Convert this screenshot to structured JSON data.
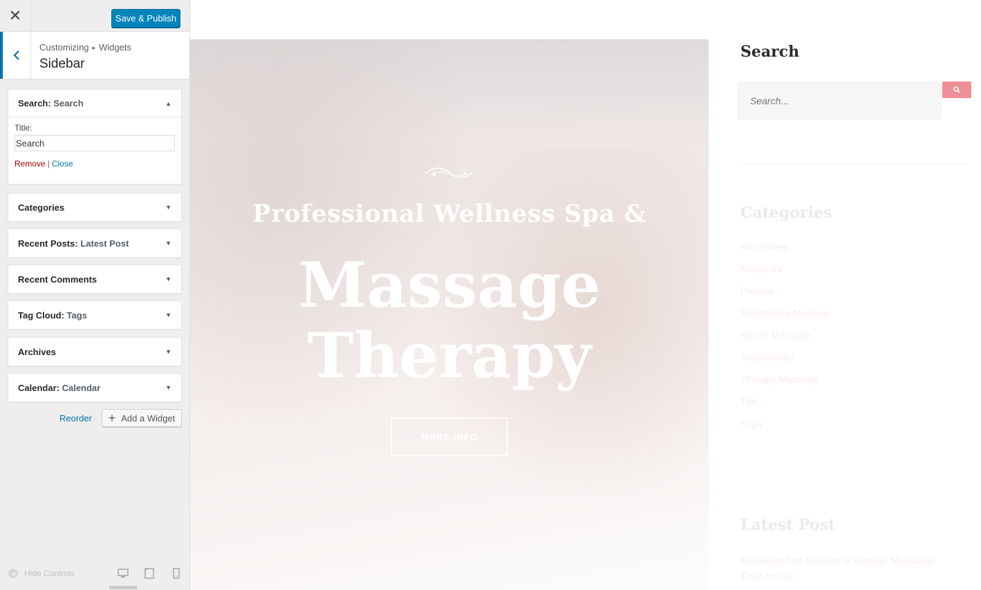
{
  "panel": {
    "close_icon": "close-icon",
    "publish_label": "Save & Publish",
    "breadcrumb_root": "Customizing",
    "breadcrumb_sep": "▸",
    "breadcrumb_current": "Widgets",
    "section_title": "Sidebar",
    "widgets": [
      {
        "type": "Search",
        "title": "Search",
        "expanded": true
      },
      {
        "type": "Categories",
        "title": ""
      },
      {
        "type": "Recent Posts",
        "title": "Latest Post"
      },
      {
        "type": "Recent Comments",
        "title": ""
      },
      {
        "type": "Tag Cloud",
        "title": "Tags"
      },
      {
        "type": "Archives",
        "title": ""
      },
      {
        "type": "Calendar",
        "title": "Calendar"
      }
    ],
    "search_widget": {
      "title_label": "Title:",
      "title_value": "Search",
      "remove_label": "Remove",
      "pipe": "|",
      "close_label": "Close"
    },
    "reorder_label": "Reorder",
    "add_widget_label": "Add a Widget",
    "hide_controls_label": "Hide Controls"
  },
  "preview": {
    "hero_subtitle": "Professional Wellness Spa &",
    "hero_title_line1": "Massage",
    "hero_title_line2": "Therapy",
    "hero_button": "MORE INFO",
    "sidebar": {
      "search_heading": "Search",
      "search_placeholder": "Search...",
      "categories_heading": "Categories",
      "categories": [
        "Hot Stones",
        "Masseurs",
        "Promos",
        "Revitalizing Massage",
        "Sports Massage",
        "Testimonials",
        "Therapy Massage",
        "Tips",
        "Yoga"
      ],
      "latest_heading": "Latest Post",
      "latest_link": "Revealing The Benefits of Regular Masssage Treat-ments"
    }
  },
  "colors": {
    "publish_blue": "#0085ba",
    "link_blue": "#0073aa",
    "remove_red": "#aa0000",
    "search_button_pink": "#ef8f97"
  }
}
